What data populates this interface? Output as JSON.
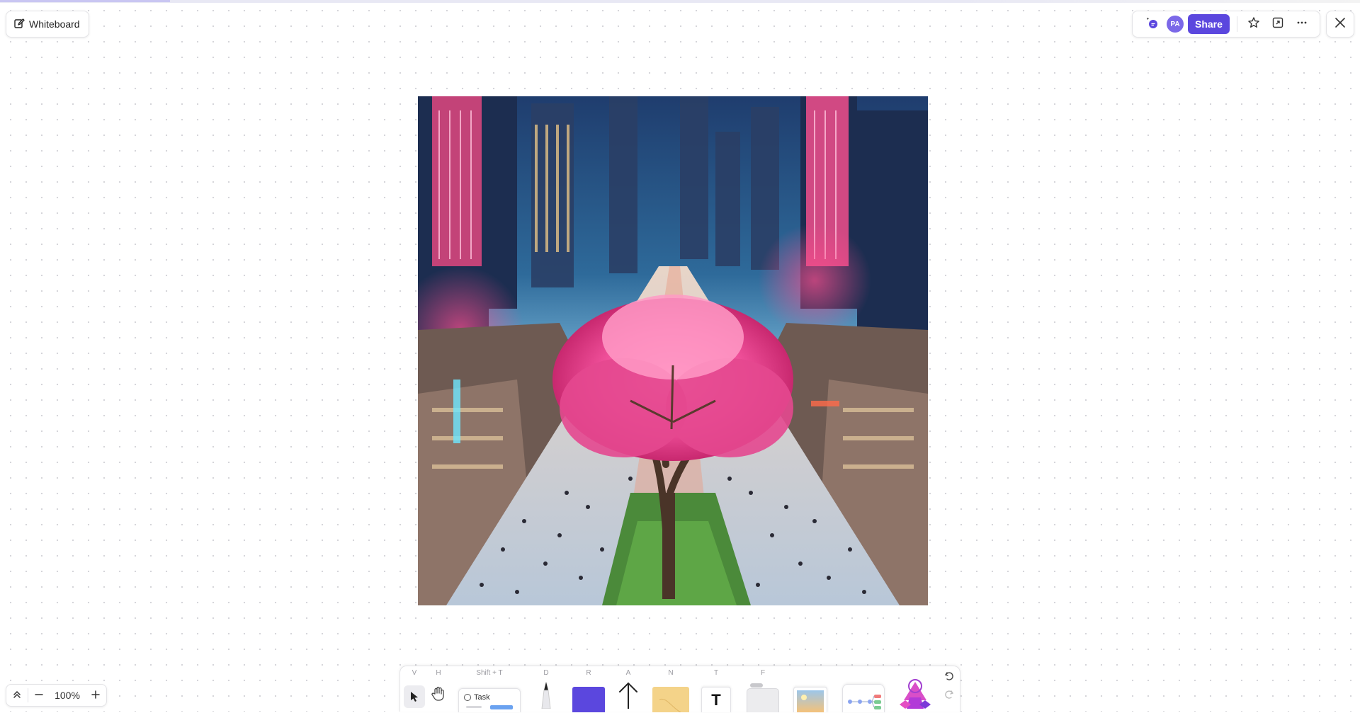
{
  "header": {
    "title": "Whiteboard",
    "avatar_initials": "PA",
    "share_label": "Share"
  },
  "zoom": {
    "level": "100%"
  },
  "toolbar": {
    "tools": [
      {
        "name": "select",
        "shortcut": "V"
      },
      {
        "name": "hand",
        "shortcut": "H"
      },
      {
        "name": "task",
        "shortcut": "Shift + T",
        "label": "Task"
      },
      {
        "name": "pen",
        "shortcut": "D"
      },
      {
        "name": "rectangle",
        "shortcut": "R"
      },
      {
        "name": "arrow",
        "shortcut": "A"
      },
      {
        "name": "sticky-note",
        "shortcut": "N"
      },
      {
        "name": "text",
        "shortcut": "T",
        "glyph": "T"
      },
      {
        "name": "frame",
        "shortcut": "F"
      },
      {
        "name": "image",
        "shortcut": ""
      },
      {
        "name": "templates",
        "shortcut": ""
      },
      {
        "name": "more-shapes",
        "shortcut": ""
      }
    ]
  },
  "colors": {
    "accent": "#5b47de",
    "avatar": "#7b68e8",
    "rectangle_tool": "#5b47de",
    "sticky_note": "#f4d389"
  },
  "icons": [
    "edit-icon",
    "comment-icon",
    "star-icon",
    "fit-screen-icon",
    "more-icon",
    "close-icon",
    "collapse-icon",
    "minus-icon",
    "plus-icon",
    "undo-icon",
    "redo-icon"
  ]
}
